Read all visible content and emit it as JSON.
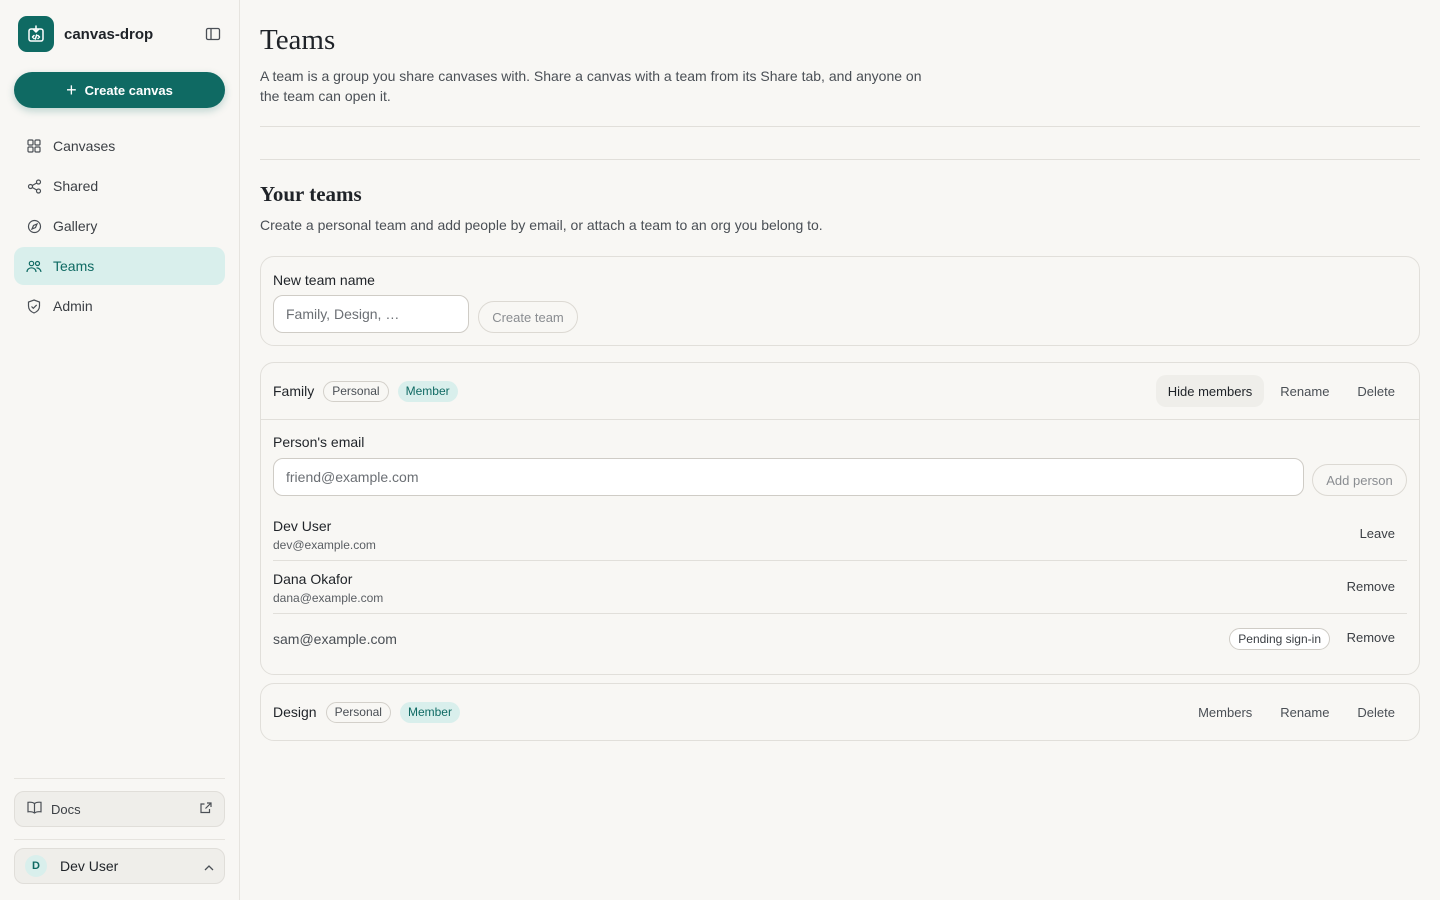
{
  "app": {
    "name": "canvas-drop"
  },
  "sidebar": {
    "create_label": "Create canvas",
    "items": [
      {
        "label": "Canvases",
        "icon": "grid-icon"
      },
      {
        "label": "Shared",
        "icon": "share-icon"
      },
      {
        "label": "Gallery",
        "icon": "compass-icon"
      },
      {
        "label": "Teams",
        "icon": "users-icon",
        "active": true
      },
      {
        "label": "Admin",
        "icon": "shield-icon"
      }
    ],
    "docs_label": "Docs",
    "user": {
      "initial": "D",
      "name": "Dev User"
    }
  },
  "page": {
    "title": "Teams",
    "description": "A team is a group you share canvases with. Share a canvas with a team from its Share tab, and anyone on the team can open it."
  },
  "your_teams": {
    "title": "Your teams",
    "description": "Create a personal team and add people by email, or attach a team to an org you belong to.",
    "new_team": {
      "label": "New team name",
      "placeholder": "Family, Design, …",
      "button": "Create team"
    }
  },
  "teams": [
    {
      "name": "Family",
      "badges": [
        "Personal",
        "Member"
      ],
      "actions": [
        "Hide members",
        "Rename",
        "Delete"
      ],
      "email_label": "Person's email",
      "email_placeholder": "friend@example.com",
      "add_button": "Add person",
      "members": [
        {
          "name": "Dev User",
          "email": "dev@example.com",
          "action": "Leave"
        },
        {
          "name": "Dana Okafor",
          "email": "dana@example.com",
          "action": "Remove"
        },
        {
          "email": "sam@example.com",
          "status": "Pending sign-in",
          "action": "Remove"
        }
      ]
    },
    {
      "name": "Design",
      "badges": [
        "Personal",
        "Member"
      ],
      "actions": [
        "Members",
        "Rename",
        "Delete"
      ]
    }
  ],
  "colors": {
    "accent": "#0f6a63",
    "accent_soft": "#d9efec",
    "background": "#f8f7f4"
  }
}
